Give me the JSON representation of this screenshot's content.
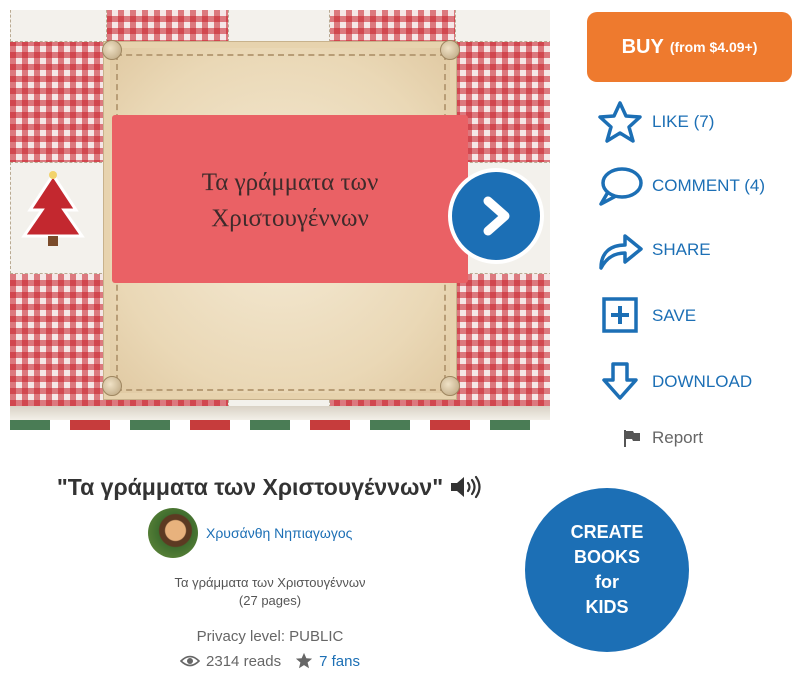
{
  "cover": {
    "title_line1": "Τα γράμματα των",
    "title_line2": "Χριστουγέννων"
  },
  "actions": {
    "buy_main": "BUY",
    "buy_sub": "(from $4.09+)",
    "like": "LIKE (7)",
    "comment": "COMMENT (4)",
    "share": "SHARE",
    "save": "SAVE",
    "download": "DOWNLOAD",
    "report": "Report"
  },
  "book": {
    "title": "\"Τα γράμματα των Χριστουγέννων\"",
    "author": "Χρυσάνθη Νηπιαγωγος",
    "description": "Τα γράμματα των Χριστουγέννων",
    "pages": "(27 pages)",
    "privacy": "Privacy level: PUBLIC",
    "reads": "2314 reads",
    "fans": "7 fans"
  },
  "create": {
    "line1": "CREATE",
    "line2": "BOOKS",
    "line3": "for",
    "line4": "KIDS"
  },
  "colors": {
    "accent_blue": "#1c6fb5",
    "buy_orange": "#ee7a2e",
    "cover_red": "#ea6165"
  },
  "icons": [
    "chevron-right-icon",
    "star-icon",
    "comment-icon",
    "share-icon",
    "save-plus-icon",
    "download-icon",
    "flag-icon",
    "speaker-icon",
    "eye-icon",
    "fan-star-icon"
  ]
}
